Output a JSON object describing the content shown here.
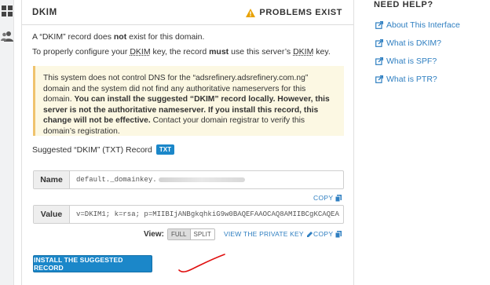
{
  "rail": {
    "icons": [
      "apps-grid-icon",
      "users-icon"
    ]
  },
  "header": {
    "title": "DKIM",
    "status": "PROBLEMS EXIST",
    "status_icon": "warning-icon",
    "warning_color": "#e8a100"
  },
  "intro": {
    "line1_pre": "A “DKIM” record does ",
    "line1_bold": "not",
    "line1_post": " exist for this domain.",
    "line2_a": "To properly configure your ",
    "line2_dkim1": "DKIM",
    "line2_b": " key, the record ",
    "line2_must": "must",
    "line2_c": " use this server’s ",
    "line2_dkim2": "DKIM",
    "line2_d": " key."
  },
  "warning": {
    "part1": "This system does not control DNS for the “adsrefinery.adsrefinery.com.ng” domain and the system did not find any authoritative nameservers for this domain. ",
    "part2_bold": "You can install the suggested “DKIM” record locally. However, this server is not the authoritative nameserver. If you install this record, this change will not be effective.",
    "part3": " Contact your domain registrar to verify this domain’s registration."
  },
  "suggested": {
    "label": "Suggested “DKIM” (TXT) Record",
    "badge": "TXT"
  },
  "name_field": {
    "label": "Name",
    "value": "default._domainkey."
  },
  "value_field": {
    "label": "Value",
    "value": "v=DKIM1; k=rsa; p=MIIBIjANBgkqhkiG9w0BAQEFAAOCAQ8AMIIBCgKCAQEA"
  },
  "copy_label": "COPY",
  "view": {
    "label": "View:",
    "full": "FULL",
    "split": "SPLIT",
    "view_private_key": "VIEW THE PRIVATE KEY"
  },
  "install_button": "INSTALL THE SUGGESTED RECORD",
  "help": {
    "title": "NEED HELP?",
    "items": [
      "About This Interface",
      "What is DKIM?",
      "What is SPF?",
      "What is PTR?"
    ]
  },
  "colors": {
    "link": "#2f7fc1",
    "primary": "#1b87c9",
    "alert_bg": "#fcf8e3",
    "alert_border": "#f0c36d",
    "annotation": "#e01010"
  }
}
